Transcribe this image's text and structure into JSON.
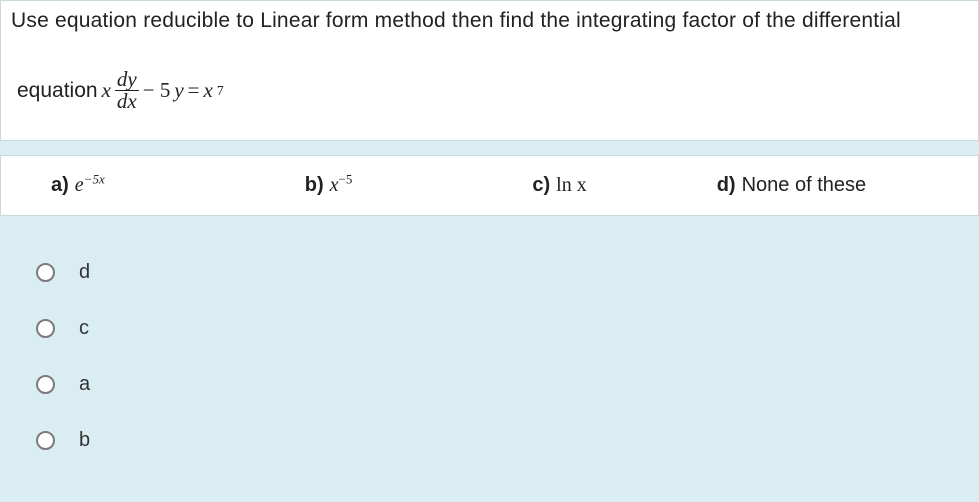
{
  "question": {
    "line1": "Use equation reducible to Linear form method then find the integrating factor of the differential",
    "eq_prefix": "equation ",
    "eq_x": "x",
    "frac_num": "dy",
    "frac_den": "dx",
    "eq_mid": " − 5",
    "eq_y": "y",
    "eq_eqsign": " = ",
    "eq_x2": "x",
    "eq_exp": "7"
  },
  "choices": {
    "a": {
      "label": "a)",
      "base": "e",
      "exp": "−5x"
    },
    "b": {
      "label": "b)",
      "base": "x",
      "exp": "−5"
    },
    "c": {
      "label": "c)",
      "text": "ln x"
    },
    "d": {
      "label": "d)",
      "text": "None of these"
    }
  },
  "radios": {
    "r1": "d",
    "r2": "c",
    "r3": "a",
    "r4": "b"
  }
}
